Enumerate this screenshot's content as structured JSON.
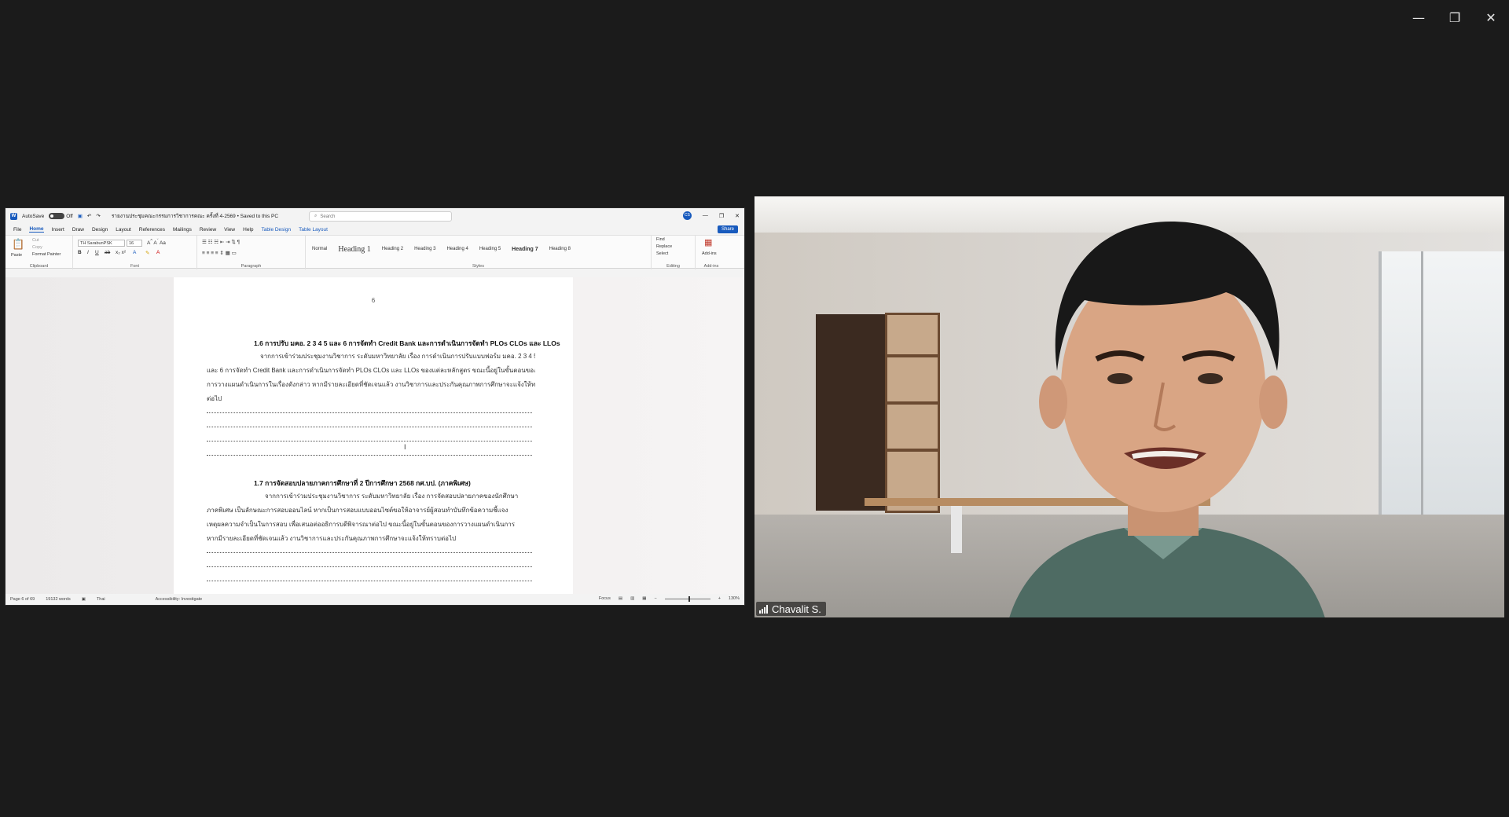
{
  "app": {
    "window_controls": [
      "—",
      "❐",
      "✕"
    ]
  },
  "word": {
    "autosave_label": "AutoSave",
    "autosave_state": "Off",
    "doc_title": "รายงานประชุมคณะกรรมการวิชาการคณะ ครั้งที่ 4-2569 • Saved to this PC",
    "search_placeholder": "Search",
    "user_initials": "CS",
    "menu": [
      "File",
      "Home",
      "Insert",
      "Draw",
      "Design",
      "Layout",
      "References",
      "Mailings",
      "Review",
      "View",
      "Help",
      "Table Design",
      "Table Layout"
    ],
    "share_label": "Share",
    "ribbon": {
      "paste": "Paste",
      "cut": "Cut",
      "copy": "Copy",
      "format_painter": "Format Painter",
      "clipboard": "Clipboard",
      "font_name": "TH SarabunPSK",
      "font_size": "16",
      "font": "Font",
      "paragraph": "Paragraph",
      "styles_label": "Styles",
      "styles": [
        "Normal",
        "Heading 1",
        "Heading 2",
        "Heading 3",
        "Heading 4",
        "Heading 5",
        "Heading 7",
        "Heading 8"
      ],
      "find": "Find",
      "replace": "Replace",
      "select": "Select",
      "editing": "Editing",
      "addins": "Add-ins",
      "addins_group": "Add-ins"
    },
    "page": {
      "number": "6",
      "heading1": "1.6 การปรับ มคอ. 2 3 4 5 และ 6 การจัดทำ Credit Bank และการดำเนินการจัดทำ PLOs CLOs และ LLOs",
      "para1": [
        "จากการเข้าร่วมประชุมงานวิชาการ ระดับมหาวิทยาลัย เรื่อง การดำเนินการปรับแบบฟอร์ม มคอ. 2 3 4 5",
        "และ 6 การจัดทำ Credit Bank และการดำเนินการจัดทำ PLOs CLOs และ LLOs ของแต่ละหลักสูตร ขณะนี้อยู่ในขั้นตอนของ",
        "การวางแผนดำเนินการในเรื่องดังกล่าว หากมีรายละเอียดที่ชัดเจนแล้ว งานวิชาการและประกันคุณภาพการศึกษาจะแจ้งให้ทราบ",
        "ต่อไป"
      ],
      "heading2": "1.7 การจัดสอบปลายภาคการศึกษาที่ 2 ปีการศึกษา 2568 กศ.บป. (ภาคพิเศษ)",
      "para2": [
        "จากการเข้าร่วมประชุมงานวิชาการ ระดับมหาวิทยาลัย เรื่อง การจัดสอบปลายภาคของนักศึกษา",
        "ภาคพิเศษ เป็นลักษณะการสอบออนไลน์ หากเป็นการสอบแบบออนไซต์ขอให้อาจารย์ผู้สอนทำบันทึกข้อความชี้แจง",
        "เหตุผลความจำเป็นในการสอบ เพื่อเสนอต่ออธิการบดีพิจารณาต่อไป ขณะนี้อยู่ในขั้นตอนของการวางแผนดำเนินการ",
        "หากมีรายละเอียดที่ชัดเจนแล้ว งานวิชาการและประกันคุณภาพการศึกษาจะแจ้งให้ทราบต่อไป"
      ]
    },
    "status": {
      "page": "Page 6 of 69",
      "words": "19132 words",
      "language": "Thai",
      "accessibility": "Accessibility: Investigate",
      "focus": "Focus",
      "zoom": "130%"
    }
  },
  "video": {
    "participant_name": "Chavalit S."
  }
}
